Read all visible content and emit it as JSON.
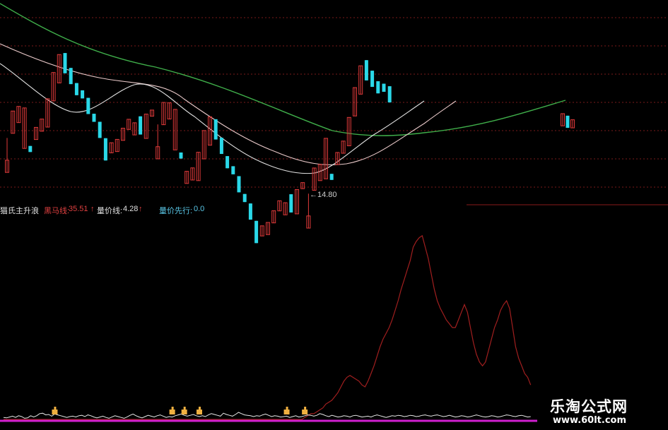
{
  "colors": {
    "background": "#000000",
    "grid": "#7a1a1a",
    "up_candle": "#e03a3a",
    "down_candle": "#2ad8e8",
    "ma_long": "#3fae4a",
    "ma_mid": "#e8c8c8",
    "ma_short": "#e0e0e0",
    "volume_line": "#a11f1f",
    "indicator_white": "#e8e8e8",
    "indicator_magenta": "#d020d0",
    "marker": "#f0b040",
    "label_red": "#e04040",
    "label_white": "#e0e0e0",
    "label_teal": "#5ac8e8"
  },
  "price_annotation": "←14.80",
  "indicator_labels": [
    {
      "key": "title",
      "text": "猫氏主升浪"
    },
    {
      "key": "hm_name",
      "text": "黑马线:"
    },
    {
      "key": "hm_value",
      "text": "35.51"
    },
    {
      "key": "hm_arrow",
      "text": "↑"
    },
    {
      "key": "ljx_name",
      "text": "量价线:"
    },
    {
      "key": "ljx_value",
      "text": "4.28"
    },
    {
      "key": "ljx_arrow",
      "text": "↑"
    },
    {
      "key": "ljxx_name",
      "text": "量价先行:"
    },
    {
      "key": "ljxx_value",
      "text": "0.0"
    }
  ],
  "watermark": {
    "title": "乐淘公式网",
    "url": "www.60lt.com"
  },
  "chart_data": {
    "type": "candlestick",
    "candles": [
      {
        "o": 13.6,
        "c": 14.2,
        "h": 15.3,
        "l": 16.9
      },
      {
        "o": 15.4,
        "c": 16.5,
        "h": 15.1,
        "l": 17.2
      },
      {
        "o": 15.8,
        "c": 16.6,
        "h": 14.9,
        "l": 17.4
      },
      {
        "o": 14.4,
        "c": 16.4,
        "h": 14.1,
        "l": 17.9
      },
      {
        "o": 14.4,
        "c": 14.1,
        "h": 13.8,
        "l": 16.6
      },
      {
        "o": 14.6,
        "c": 15.2,
        "h": 14.3,
        "l": 15.6
      },
      {
        "o": 14.9,
        "c": 15.5,
        "h": 14.6,
        "l": 15.8
      },
      {
        "o": 15.0,
        "c": 16.4,
        "h": 14.7,
        "l": 16.7
      },
      {
        "o": 16.2,
        "c": 17.6,
        "h": 15.8,
        "l": 18.0
      },
      {
        "o": 17.0,
        "c": 18.4,
        "h": 16.5,
        "l": 18.6
      },
      {
        "o": 18.4,
        "c": 17.4,
        "h": 16.9,
        "l": 18.7
      },
      {
        "o": 17.6,
        "c": 16.8,
        "h": 16.0,
        "l": 17.9
      },
      {
        "o": 16.8,
        "c": 16.2,
        "h": 15.9,
        "l": 17.1
      },
      {
        "o": 16.4,
        "c": 16.0,
        "h": 15.8,
        "l": 16.7
      },
      {
        "o": 16.0,
        "c": 15.2,
        "h": 14.3,
        "l": 16.3
      },
      {
        "o": 15.2,
        "c": 14.8,
        "h": 14.0,
        "l": 15.4
      },
      {
        "o": 14.8,
        "c": 14.0,
        "h": 13.0,
        "l": 15.1
      },
      {
        "o": 14.0,
        "c": 12.9,
        "h": 12.0,
        "l": 14.2
      },
      {
        "o": 13.3,
        "c": 13.8,
        "h": 13.2,
        "l": 14.3
      },
      {
        "o": 13.4,
        "c": 14.0,
        "h": 13.0,
        "l": 14.4
      },
      {
        "o": 14.0,
        "c": 14.6,
        "h": 13.8,
        "l": 15.0
      },
      {
        "o": 14.6,
        "c": 15.1,
        "h": 14.2,
        "l": 15.3
      },
      {
        "o": 14.4,
        "c": 15.0,
        "h": 14.0,
        "l": 15.2
      },
      {
        "o": 15.4,
        "c": 14.5,
        "h": 14.3,
        "l": 15.6
      },
      {
        "o": 14.4,
        "c": 15.6,
        "h": 14.2,
        "l": 15.8
      },
      {
        "o": 15.6,
        "c": 15.9,
        "h": 15.2,
        "l": 16.4
      }
    ],
    "moving_averages": [
      {
        "name": "",
        "color_key": "ma_long"
      },
      {
        "name": "",
        "color_key": "ma_mid"
      },
      {
        "name": "",
        "color_key": "ma_short"
      }
    ],
    "indicator_series": [
      {
        "name": "黑马线",
        "values": [
          0,
          0,
          0,
          0,
          0,
          0,
          0,
          0,
          0,
          0,
          0,
          0,
          0,
          0,
          0,
          0,
          0,
          0,
          0,
          0,
          0,
          0,
          0,
          0,
          0,
          0,
          0,
          0,
          0,
          0,
          0,
          0,
          0,
          0,
          0,
          0,
          0,
          0,
          0,
          0,
          0,
          0,
          0,
          0,
          0,
          0,
          0,
          0,
          0,
          0,
          0,
          0,
          0,
          0,
          0,
          0,
          0,
          0,
          0,
          0,
          0,
          0,
          0,
          0,
          0,
          0,
          0,
          0,
          0,
          0,
          0,
          0,
          0,
          0,
          0,
          0,
          0,
          0,
          0,
          0,
          0,
          0,
          0,
          0,
          0,
          0,
          0,
          0,
          0,
          0,
          0,
          0,
          0,
          0,
          0,
          0,
          0,
          0,
          0,
          0,
          1,
          2,
          3,
          3,
          4,
          5,
          6,
          8,
          9,
          10,
          12,
          14,
          17,
          20,
          22,
          23,
          22,
          21,
          20,
          18,
          17,
          20,
          24,
          28,
          33,
          38,
          42,
          45,
          48,
          52,
          57,
          62,
          68,
          73,
          78,
          83,
          90,
          93,
          95,
          96,
          90,
          84,
          76,
          68,
          62,
          58,
          55,
          52,
          50,
          48,
          48,
          52,
          56,
          60,
          56,
          48,
          40,
          34,
          30,
          28,
          30,
          36,
          42,
          48,
          52,
          57,
          60,
          62,
          58,
          48,
          38,
          32,
          28,
          24,
          22,
          18
        ],
        "max": 100
      },
      {
        "name": "量价线",
        "values": [
          1.6,
          1.4,
          1.8,
          2.2,
          1.6,
          2.4,
          2.0,
          1.2,
          1.4,
          2.4,
          1.8,
          2.4,
          3.4,
          3.6,
          2.8,
          3.0,
          2.2,
          3.2,
          2.8,
          2.4,
          2.0,
          1.6,
          2.0,
          2.2,
          1.8,
          2.4,
          2.6,
          2.0,
          2.8,
          2.4,
          1.8,
          1.4,
          1.8,
          2.2,
          1.6,
          1.2,
          1.8,
          2.4,
          2.0,
          1.6,
          1.2,
          1.8,
          2.6,
          3.2,
          2.4,
          1.8,
          1.4,
          2.0,
          2.6,
          2.2,
          1.8,
          2.4,
          2.8,
          2.2,
          1.6,
          2.0,
          1.8,
          2.4,
          2.8,
          3.2,
          2.6,
          2.2,
          2.6,
          3.0,
          2.4,
          2.0,
          2.4,
          2.0,
          2.8,
          3.4,
          3.0,
          2.6,
          2.2,
          3.6,
          3.0,
          2.6,
          2.2,
          3.0,
          4.0,
          3.4,
          2.8,
          2.6,
          2.4,
          2.0,
          2.4,
          2.2,
          2.8,
          3.2,
          2.6,
          2.0,
          2.4,
          2.2,
          1.8,
          2.0,
          2.2,
          1.6,
          2.0,
          2.4,
          1.8,
          2.0,
          2.4,
          2.8,
          2.6,
          2.2,
          2.6,
          3.4,
          3.0,
          2.4,
          2.0,
          2.6,
          2.2,
          1.8,
          2.0,
          2.4,
          2.2,
          1.8,
          2.4,
          2.6,
          2.2,
          1.8,
          2.0,
          2.2,
          1.8,
          2.4,
          2.8,
          2.4,
          2.0,
          1.6,
          2.0,
          2.4,
          2.2,
          2.6,
          2.4,
          2.0,
          2.2,
          2.6,
          2.4,
          2.0,
          2.2,
          2.6,
          2.8,
          2.4,
          2.2,
          2.6,
          2.8,
          2.4,
          2.0,
          2.2,
          2.6,
          2.2,
          1.8,
          2.0,
          2.4,
          2.2,
          1.8,
          2.0,
          2.4,
          2.8,
          2.4,
          2.0,
          1.8,
          2.0,
          2.4,
          2.2,
          1.8,
          2.0,
          2.4,
          2.8,
          2.6,
          2.2,
          2.0,
          2.4,
          2.6,
          2.2,
          1.8,
          2.0
        ],
        "max": 10
      }
    ],
    "signal_markers": [
      17,
      56,
      60,
      65,
      94,
      100
    ]
  }
}
